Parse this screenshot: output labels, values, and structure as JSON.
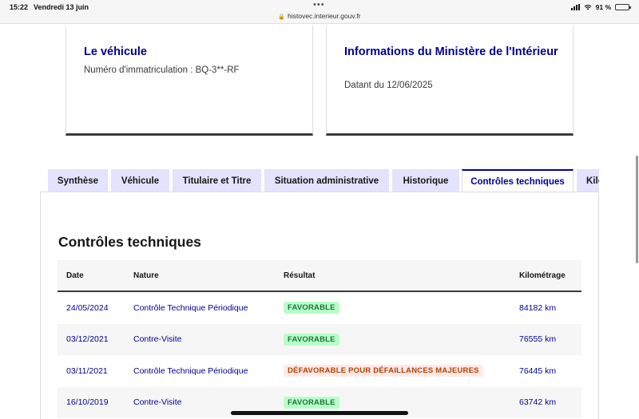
{
  "status_bar": {
    "time": "15:22",
    "date": "Vendredi 13 juin",
    "url": "histovec.interieur.gouv.fr",
    "battery": "91 %",
    "battery_level": 0.91
  },
  "cards": {
    "vehicle": {
      "title": "Le véhicule",
      "subtitle": "Numéro d'immatriculation : BQ-3**-RF"
    },
    "ministry": {
      "title": "Informations du Ministère de l'Intérieur",
      "subtitle": "Datant du 12/06/2025"
    }
  },
  "tabs": [
    {
      "label": "Synthèse"
    },
    {
      "label": "Véhicule"
    },
    {
      "label": "Titulaire et Titre"
    },
    {
      "label": "Situation administrative"
    },
    {
      "label": "Historique"
    },
    {
      "label": "Contrôles techniques"
    },
    {
      "label": "Kilométrage"
    }
  ],
  "active_tab": "Contrôles techniques",
  "section": {
    "title": "Contrôles techniques"
  },
  "table": {
    "headers": [
      "Date",
      "Nature",
      "Résultat",
      "Kilométrage"
    ],
    "rows": [
      {
        "date": "24/05/2024",
        "nature": "Contrôle Technique Périodique",
        "result": "FAVORABLE",
        "km": "84182 km"
      },
      {
        "date": "03/12/2021",
        "nature": "Contre-Visite",
        "result": "FAVORABLE",
        "km": "76555 km"
      },
      {
        "date": "03/11/2021",
        "nature": "Contrôle Technique Périodique",
        "result": "DÉFAVORABLE POUR DÉFAILLANCES MAJEURES",
        "km": "76445 km"
      },
      {
        "date": "16/10/2019",
        "nature": "Contre-Visite",
        "result": "FAVORABLE",
        "km": "63742 km"
      }
    ]
  },
  "colors": {
    "primary": "#000091",
    "favorable_bg": "#b8fec9",
    "favorable_text": "#18753c",
    "defavorable_bg": "#ffe9e6",
    "defavorable_text": "#b34000"
  }
}
